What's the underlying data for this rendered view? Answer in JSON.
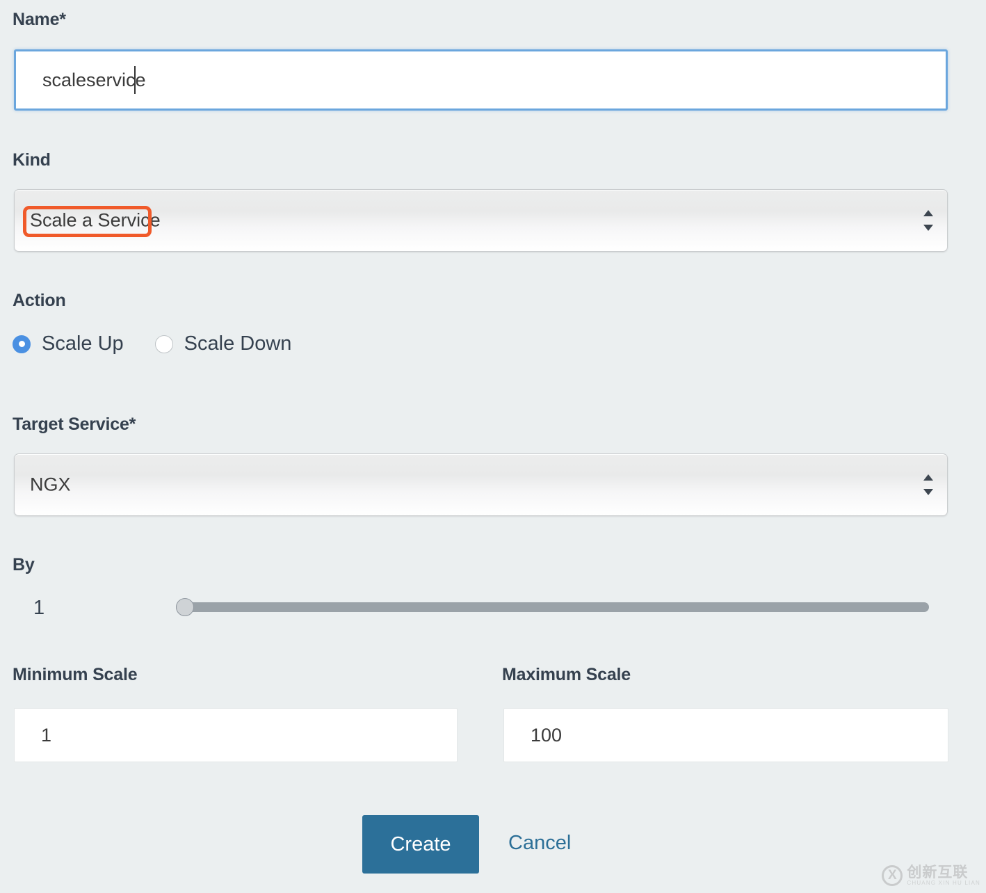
{
  "form": {
    "name": {
      "label": "Name*",
      "value": "scaleservice",
      "placeholder": ""
    },
    "kind": {
      "label": "Kind",
      "selected": "Scale a Service",
      "highlighted": true,
      "highlight_color": "#f05a2a"
    },
    "action": {
      "label": "Action",
      "options": [
        {
          "label": "Scale Up",
          "selected": true
        },
        {
          "label": "Scale Down",
          "selected": false
        }
      ],
      "selected_color": "#4a90e2"
    },
    "target_service": {
      "label": "Target Service*",
      "selected": "NGX"
    },
    "by": {
      "label": "By",
      "value": "1",
      "slider_position_percent": 0
    },
    "minimum_scale": {
      "label": "Minimum Scale",
      "value": "1"
    },
    "maximum_scale": {
      "label": "Maximum Scale",
      "value": "100"
    },
    "actions": {
      "create_label": "Create",
      "create_color": "#2c7099",
      "cancel_label": "Cancel",
      "cancel_color": "#2c6f97"
    }
  },
  "watermark": {
    "mark": "X",
    "chinese": "创新互联",
    "pinyin": "CHUANG XIN HU LIAN"
  }
}
